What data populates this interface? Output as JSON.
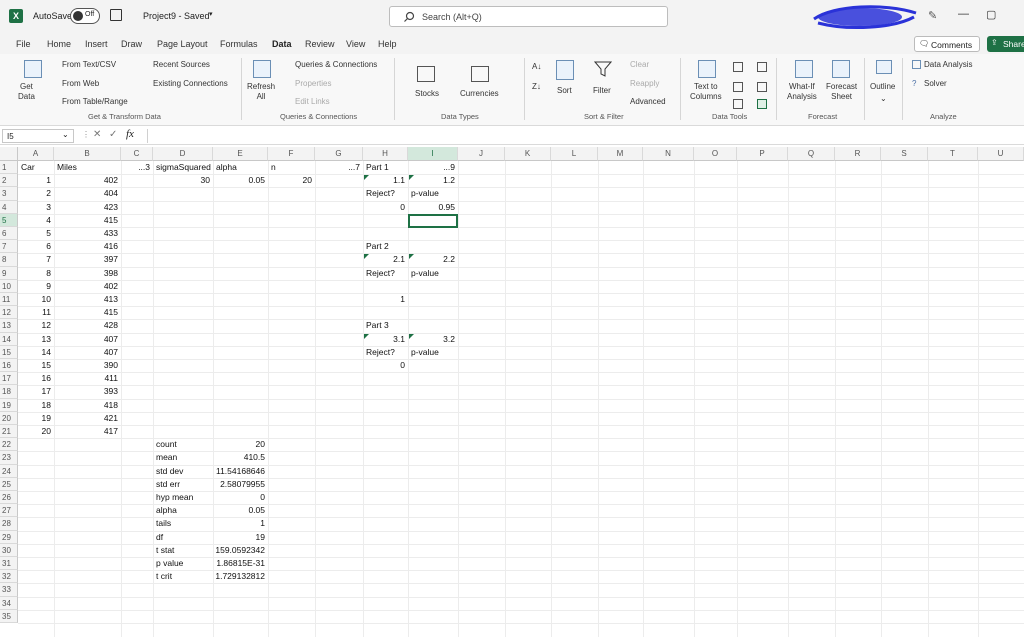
{
  "titlebar": {
    "autosave_label": "AutoSave",
    "autosave_state": "Off",
    "doc_title": "Project9 - Saved",
    "search_placeholder": "Search (Alt+Q)"
  },
  "tabs": [
    "File",
    "Home",
    "Insert",
    "Draw",
    "Page Layout",
    "Formulas",
    "Data",
    "Review",
    "View",
    "Help"
  ],
  "active_tab": "Data",
  "actions": {
    "comments": "Comments",
    "share": "Share"
  },
  "ribbon": {
    "get_data": "Get\nData",
    "from_text": "From Text/CSV",
    "from_web": "From Web",
    "from_table": "From Table/Range",
    "recent_sources": "Recent Sources",
    "existing_connections": "Existing Connections",
    "group_get": "Get & Transform Data",
    "refresh_all": "Refresh\nAll",
    "queries_connections": "Queries & Connections",
    "properties": "Properties",
    "edit_links": "Edit Links",
    "group_queries": "Queries & Connections",
    "stocks": "Stocks",
    "currencies": "Currencies",
    "group_types": "Data Types",
    "sort": "Sort",
    "filter": "Filter",
    "clear": "Clear",
    "reapply": "Reapply",
    "advanced": "Advanced",
    "group_sort": "Sort & Filter",
    "text_to_columns": "Text to\nColumns",
    "group_tools": "Data Tools",
    "what_if": "What-If\nAnalysis",
    "forecast_sheet": "Forecast\nSheet",
    "group_forecast": "Forecast",
    "outline": "Outline",
    "data_analysis": "Data Analysis",
    "solver": "Solver",
    "group_analyze": "Analyze"
  },
  "name_box": "I5",
  "columns": [
    "A",
    "B",
    "C",
    "D",
    "E",
    "F",
    "G",
    "H",
    "I",
    "J",
    "K",
    "L",
    "M",
    "N",
    "O",
    "P",
    "Q",
    "R",
    "S",
    "T",
    "U"
  ],
  "rows": [
    "1",
    "2",
    "3",
    "4",
    "5",
    "6",
    "7",
    "8",
    "9",
    "10",
    "11",
    "12",
    "13",
    "14",
    "15",
    "16",
    "17",
    "18",
    "19",
    "20",
    "21",
    "22",
    "23",
    "24",
    "25",
    "26",
    "27",
    "28",
    "29",
    "30",
    "31",
    "32",
    "33",
    "34",
    "35"
  ],
  "cells": {
    "A1": "Car",
    "B1": "Miles",
    "C1": "...3",
    "D1": "sigmaSquared",
    "E1": "alpha",
    "F1": "n",
    "G1": "...7",
    "H1": "Part 1",
    "I1": "...9",
    "D2": "30",
    "E2": "0.05",
    "F2": "20",
    "H2": "1.1",
    "I2": "1.2",
    "H3": "Reject?",
    "I3": "p-value",
    "H4": "0",
    "I4": "0.95",
    "H7": "Part 2",
    "H8": "2.1",
    "I8": "2.2",
    "H9": "Reject?",
    "I9": "p-value",
    "H11": "1",
    "H13": "Part 3",
    "H14": "3.1",
    "I14": "3.2",
    "H15": "Reject?",
    "I15": "p-value",
    "H16": "0",
    "D22": "count",
    "E22": "20",
    "D23": "mean",
    "E23": "410.5",
    "D24": "std dev",
    "E24": "11.54168646",
    "D25": "std err",
    "E25": "2.58079955",
    "D26": "hyp mean",
    "E26": "0",
    "D27": "alpha",
    "E27": "0.05",
    "D28": "tails",
    "E28": "1",
    "D29": "df",
    "E29": "19",
    "D30": "t stat",
    "E30": "159.0592342",
    "D31": "p value",
    "E31": "1.86815E-31",
    "D32": "t crit",
    "E32": "1.729132812"
  },
  "car_ids": [
    "1",
    "2",
    "3",
    "4",
    "5",
    "6",
    "7",
    "8",
    "9",
    "10",
    "11",
    "12",
    "13",
    "14",
    "15",
    "16",
    "17",
    "18",
    "19",
    "20"
  ],
  "miles": [
    "402",
    "404",
    "423",
    "415",
    "433",
    "416",
    "397",
    "398",
    "402",
    "413",
    "415",
    "428",
    "407",
    "407",
    "390",
    "411",
    "393",
    "418",
    "421",
    "417"
  ]
}
